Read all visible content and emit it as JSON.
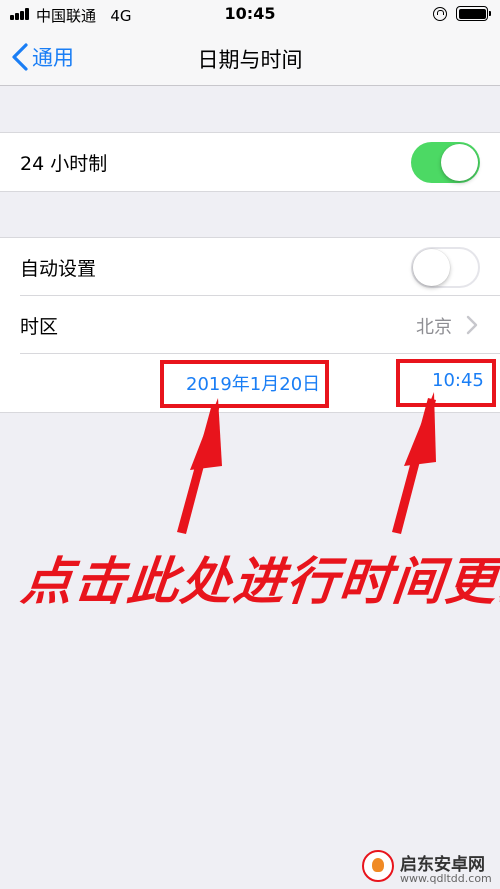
{
  "status_bar": {
    "carrier": "中国联通",
    "network": "4G",
    "time": "10:45"
  },
  "nav": {
    "back_label": "通用",
    "title": "日期与时间"
  },
  "settings": {
    "hour24_label": "24 小时制",
    "hour24_on": true,
    "auto_label": "自动设置",
    "auto_on": false,
    "timezone_label": "时区",
    "timezone_value": "北京",
    "date_value": "2019年1月20日",
    "time_value": "10:45"
  },
  "annotation": {
    "text": "点击此处进行时间更改",
    "color": "#e8141c"
  },
  "watermark": {
    "name": "启东安卓网",
    "url": "www.qdltdd.com"
  },
  "colors": {
    "accent": "#1a7ef5",
    "toggle_on": "#4cd964",
    "background": "#efeff4"
  }
}
